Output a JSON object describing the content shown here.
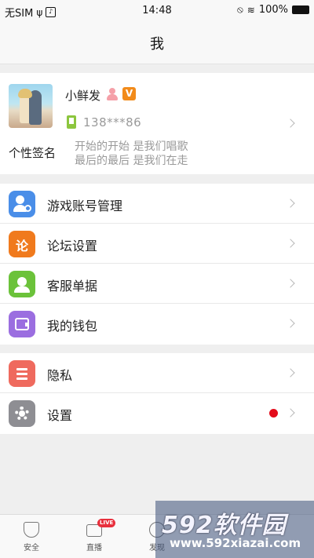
{
  "status_bar": {
    "carrier": "无SIM",
    "time": "14:48",
    "battery": "100%"
  },
  "nav": {
    "title": "我"
  },
  "profile": {
    "username": "小鲜发",
    "verified_badge": "V",
    "phone": "138***86",
    "signature_label": "个性签名",
    "signature_lines": [
      "开始的开始 是我们唱歌",
      "最后的最后 是我们在走"
    ]
  },
  "menu_group_1": [
    {
      "label": "游戏账号管理",
      "icon": "user-settings-icon",
      "color": "#4a8ee8"
    },
    {
      "label": "论坛设置",
      "icon": "forum-settings-icon",
      "color": "#f07a1d"
    },
    {
      "label": "客服单据",
      "icon": "customer-service-icon",
      "color": "#6bc23a"
    },
    {
      "label": "我的钱包",
      "icon": "wallet-icon",
      "color": "#9b6ee0"
    }
  ],
  "menu_group_2": [
    {
      "label": "隐私",
      "icon": "privacy-icon",
      "color": "#ef6a5e"
    },
    {
      "label": "设置",
      "icon": "gear-icon",
      "color": "#8e8e93"
    }
  ],
  "tabbar": {
    "tabs": [
      {
        "label": "安全",
        "icon": "shield-icon"
      },
      {
        "label": "直播",
        "icon": "live-tv-icon",
        "badge": "LIVE"
      },
      {
        "label": "发现",
        "icon": "discover-icon"
      }
    ]
  },
  "watermark": {
    "logo": "592软件园",
    "url": "www.592xiazai.com"
  }
}
